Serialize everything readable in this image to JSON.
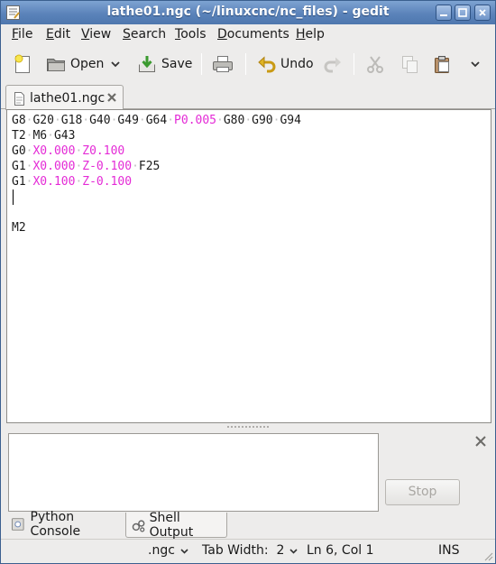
{
  "window": {
    "title": "lathe01.ngc (~/linuxcnc/nc_files) - gedit"
  },
  "menu": {
    "items": [
      {
        "first": "F",
        "rest": "ile"
      },
      {
        "first": "E",
        "rest": "dit"
      },
      {
        "first": "V",
        "rest": "iew"
      },
      {
        "first": "S",
        "rest": "earch"
      },
      {
        "first": "T",
        "rest": "ools"
      },
      {
        "first": "D",
        "rest": "ocuments"
      },
      {
        "first": "H",
        "rest": "elp"
      }
    ]
  },
  "toolbar": {
    "open_label": "Open",
    "save_label": "Save",
    "undo_label": "Undo"
  },
  "tab": {
    "label": "lathe01.ngc"
  },
  "editor": {
    "lines": [
      [
        {
          "t": "G8",
          "c": "k"
        },
        {
          "t": "·",
          "c": "d"
        },
        {
          "t": "G20",
          "c": "k"
        },
        {
          "t": "·",
          "c": "d"
        },
        {
          "t": "G18",
          "c": "k"
        },
        {
          "t": "·",
          "c": "d"
        },
        {
          "t": "G40",
          "c": "k"
        },
        {
          "t": "·",
          "c": "d"
        },
        {
          "t": "G49",
          "c": "k"
        },
        {
          "t": "·",
          "c": "d"
        },
        {
          "t": "G64",
          "c": "k"
        },
        {
          "t": "·",
          "c": "d"
        },
        {
          "t": "P0.005",
          "c": "m"
        },
        {
          "t": "·",
          "c": "d"
        },
        {
          "t": "G80",
          "c": "k"
        },
        {
          "t": "·",
          "c": "d"
        },
        {
          "t": "G90",
          "c": "k"
        },
        {
          "t": "·",
          "c": "d"
        },
        {
          "t": "G94",
          "c": "k"
        }
      ],
      [
        {
          "t": "T2",
          "c": "k"
        },
        {
          "t": "·",
          "c": "d"
        },
        {
          "t": "M6",
          "c": "k"
        },
        {
          "t": "·",
          "c": "d"
        },
        {
          "t": "G43",
          "c": "k"
        }
      ],
      [
        {
          "t": "G0",
          "c": "k"
        },
        {
          "t": "·",
          "c": "d"
        },
        {
          "t": "X0.000",
          "c": "m"
        },
        {
          "t": "·",
          "c": "d"
        },
        {
          "t": "Z0.100",
          "c": "m"
        }
      ],
      [
        {
          "t": "G1",
          "c": "k"
        },
        {
          "t": "·",
          "c": "d"
        },
        {
          "t": "X0.000",
          "c": "m"
        },
        {
          "t": "·",
          "c": "d"
        },
        {
          "t": "Z-0.100",
          "c": "m"
        },
        {
          "t": "·",
          "c": "d"
        },
        {
          "t": "F25",
          "c": "k"
        }
      ],
      [
        {
          "t": "G1",
          "c": "k"
        },
        {
          "t": "·",
          "c": "d"
        },
        {
          "t": "X0.100",
          "c": "m"
        },
        {
          "t": "·",
          "c": "d"
        },
        {
          "t": "Z-0.100",
          "c": "m"
        }
      ],
      [],
      [],
      [
        {
          "t": "M2",
          "c": "k"
        }
      ]
    ],
    "highlight_color": "#e42ad6"
  },
  "panel": {
    "stop_label": "Stop",
    "tabs": {
      "python_console": "Python Console",
      "shell_output": "Shell Output"
    }
  },
  "status": {
    "language": ".ngc",
    "tab_width": "Tab Width:  2",
    "position": "Ln 6, Col 1",
    "mode": "INS"
  },
  "icons": [
    "gedit-app-icon",
    "minimize-icon",
    "maximize-icon",
    "close-icon",
    "new-document-icon",
    "open-folder-icon",
    "chevron-down-icon",
    "save-icon",
    "print-icon",
    "undo-icon",
    "redo-icon",
    "cut-icon",
    "copy-icon",
    "paste-icon",
    "document-icon",
    "python-icon",
    "shell-icon",
    "resize-grip-icon"
  ]
}
